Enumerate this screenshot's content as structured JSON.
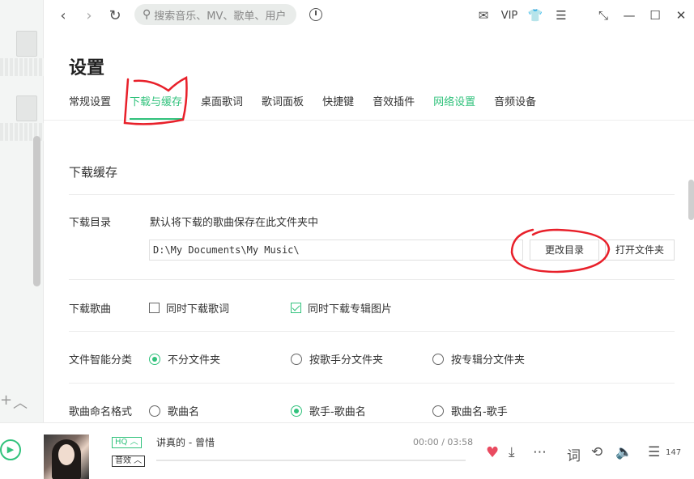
{
  "topbar": {
    "search_placeholder": "搜索音乐、MV、歌单、用户",
    "vip_label": "VIP"
  },
  "settings": {
    "title": "设置",
    "tabs": [
      "常规设置",
      "下载与缓存",
      "桌面歌词",
      "歌词面板",
      "快捷键",
      "音效插件",
      "网络设置",
      "音频设备"
    ],
    "active_tab": 1,
    "section_title": "下载缓存",
    "download_dir": {
      "label": "下载目录",
      "description": "默认将下载的歌曲保存在此文件夹中",
      "path": "D:\\My Documents\\My Music\\",
      "change_button": "更改目录",
      "open_button": "打开文件夹"
    },
    "download_song": {
      "label": "下载歌曲",
      "options": [
        {
          "text": "同时下载歌词",
          "checked": false
        },
        {
          "text": "同时下载专辑图片",
          "checked": true
        }
      ]
    },
    "smart_folder": {
      "label": "文件智能分类",
      "options": [
        {
          "text": "不分文件夹",
          "selected": true
        },
        {
          "text": "按歌手分文件夹",
          "selected": false
        },
        {
          "text": "按专辑分文件夹",
          "selected": false
        }
      ]
    },
    "naming": {
      "label": "歌曲命名格式",
      "options": [
        {
          "text": "歌曲名",
          "selected": false
        },
        {
          "text": "歌手-歌曲名",
          "selected": true
        },
        {
          "text": "歌曲名-歌手",
          "selected": false
        }
      ]
    }
  },
  "player": {
    "quality_tag": "HQ",
    "effect_tag": "音效",
    "song_title": "讲真的 - 曾惜",
    "time": "00:00 / 03:58",
    "playlist_count": "147"
  },
  "colors": {
    "accent": "#31c27c",
    "annotation": "#e8202a",
    "heart": "#e94b60"
  }
}
